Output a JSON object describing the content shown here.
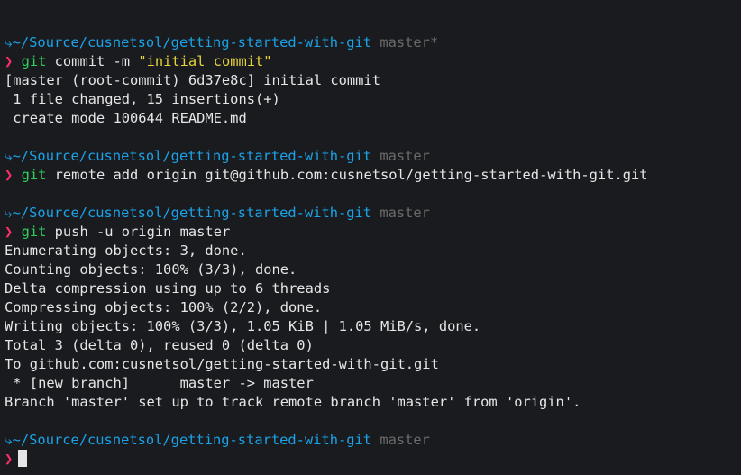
{
  "prompt_symbol": "❯",
  "path": "~/Source/cusnetsol/getting-started-with-git",
  "path_prefix": "⤷",
  "blocks": [
    {
      "branch": "master*",
      "cmd_git": "git",
      "cmd_rest": " commit -m ",
      "cmd_str": "\"initial commit\"",
      "output": [
        "[master (root-commit) 6d37e8c] initial commit",
        " 1 file changed, 15 insertions(+)",
        " create mode 100644 README.md"
      ]
    },
    {
      "branch": "master",
      "cmd_git": "git",
      "cmd_rest": " remote add origin git@github.com:cusnetsol/getting-started-with-git.git",
      "output": []
    },
    {
      "branch": "master",
      "cmd_git": "git",
      "cmd_rest": " push -u origin master",
      "output": [
        "Enumerating objects: 3, done.",
        "Counting objects: 100% (3/3), done.",
        "Delta compression using up to 6 threads",
        "Compressing objects: 100% (2/2), done.",
        "Writing objects: 100% (3/3), 1.05 KiB | 1.05 MiB/s, done.",
        "Total 3 (delta 0), reused 0 (delta 0)",
        "To github.com:cusnetsol/getting-started-with-git.git",
        " * [new branch]      master -> master",
        "Branch 'master' set up to track remote branch 'master' from 'origin'."
      ]
    },
    {
      "branch": "master"
    }
  ],
  "colors": {
    "background": "#1a1b1f",
    "path": "#1aa3e8",
    "branch": "#6b6b6b",
    "prompt": "#ff2e6b",
    "git": "#2dd15a",
    "string": "#e5d33a",
    "text": "#e6e6e6"
  }
}
